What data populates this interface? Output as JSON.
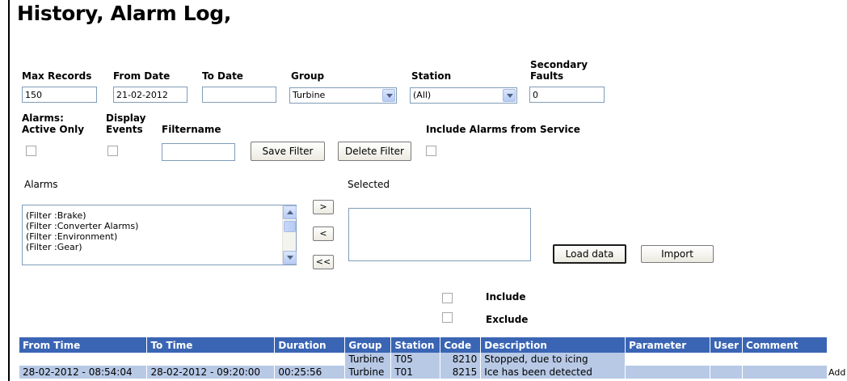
{
  "page": {
    "title": "History, Alarm Log,"
  },
  "filters": {
    "max_records": {
      "label": "Max Records",
      "value": "150"
    },
    "from_date": {
      "label": "From Date",
      "value": "21-02-2012"
    },
    "to_date": {
      "label": "To Date",
      "value": ""
    },
    "group": {
      "label": "Group",
      "value": "Turbine"
    },
    "station": {
      "label": "Station",
      "value": "(All)"
    },
    "secondary_faults": {
      "label_line1": "Secondary",
      "label_line2": "Faults",
      "value": "0"
    },
    "alarms_active_only": {
      "label_line1": "Alarms:",
      "label_line2": "Active Only",
      "checked": false
    },
    "display_events": {
      "label_line1": "Display",
      "label_line2": "Events",
      "checked": false
    },
    "filtername": {
      "label": "Filtername",
      "value": ""
    },
    "save_filter_label": "Save Filter",
    "delete_filter_label": "Delete Filter",
    "include_service": {
      "label": "Include Alarms from Service",
      "checked": false
    }
  },
  "alarms": {
    "label": "Alarms",
    "items": [
      "(Filter :Brake)",
      "(Filter :Converter Alarms)",
      "(Filter :Environment)",
      "(Filter :Gear)"
    ]
  },
  "move_buttons": {
    "add": ">",
    "remove": "<",
    "remove_all": "<<"
  },
  "selected": {
    "label": "Selected",
    "items": []
  },
  "actions": {
    "load_data_label": "Load data",
    "import_label": "Import"
  },
  "include_exclude": {
    "include_label": "Include",
    "exclude_label": "Exclude"
  },
  "table": {
    "columns": [
      "From Time",
      "To Time",
      "Duration",
      "Group",
      "Station",
      "Code",
      "Description",
      "Parameter",
      "User",
      "Comment"
    ],
    "rows": [
      {
        "from": "",
        "to": "",
        "duration": "",
        "group": "Turbine",
        "station": "T05",
        "code": "8210",
        "description": "Stopped, due to icing",
        "parameter": "",
        "user": "",
        "comment": ""
      },
      {
        "from": "28-02-2012 - 08:54:04",
        "to": "28-02-2012 - 09:20:00",
        "duration": "00:25:56",
        "group": "Turbine",
        "station": "T01",
        "code": "8215",
        "description": "Ice has been detected",
        "parameter": "",
        "user": "",
        "comment": ""
      }
    ],
    "add_label": "Add"
  }
}
